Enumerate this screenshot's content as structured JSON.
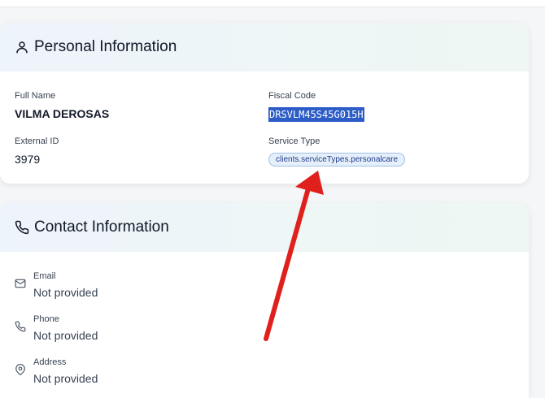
{
  "personal": {
    "title": "Personal Information",
    "full_name_label": "Full Name",
    "full_name_value": "VILMA DEROSAS",
    "fiscal_code_label": "Fiscal Code",
    "fiscal_code_value": "DRSVLM45S45G015H",
    "external_id_label": "External ID",
    "external_id_value": "3979",
    "service_type_label": "Service Type",
    "service_type_value": "clients.serviceTypes.personalcare"
  },
  "contact": {
    "title": "Contact Information",
    "email_label": "Email",
    "email_value": "Not provided",
    "phone_label": "Phone",
    "phone_value": "Not provided",
    "address_label": "Address",
    "address_value": "Not provided"
  },
  "icons": {
    "personal": "user-icon",
    "contact": "phone-icon",
    "email": "mail-icon",
    "phone": "phone-icon",
    "address": "map-pin-icon"
  },
  "colors": {
    "highlight": "#2b5cc7",
    "badge_bg": "#e6f0fb",
    "arrow": "#e0201c"
  }
}
